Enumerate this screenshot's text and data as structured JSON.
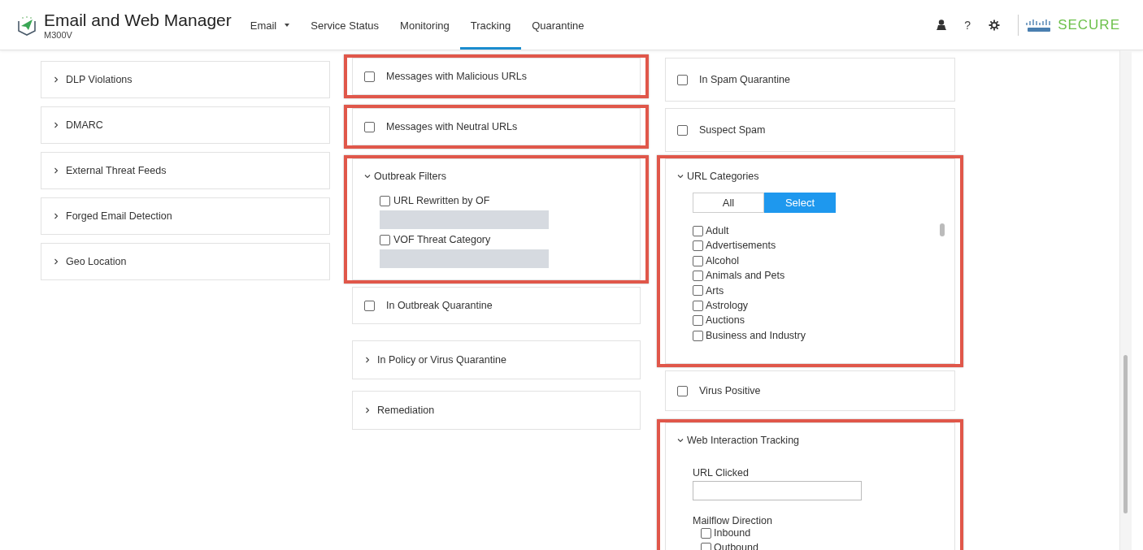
{
  "header": {
    "title": "Email and Web Manager",
    "model": "M300V",
    "nav": [
      {
        "label": "Email",
        "dropdown": true,
        "selected": false
      },
      {
        "label": "Service Status",
        "dropdown": false,
        "selected": false
      },
      {
        "label": "Monitoring",
        "dropdown": false,
        "selected": false
      },
      {
        "label": "Tracking",
        "dropdown": false,
        "selected": true
      },
      {
        "label": "Quarantine",
        "dropdown": false,
        "selected": false
      }
    ],
    "help": "?",
    "brand": "SECURE"
  },
  "columns": [
    {
      "cards": [
        {
          "kind": "collapsed",
          "label": "DLP Violations",
          "highlighted": false
        },
        {
          "kind": "collapsed",
          "label": "DMARC",
          "highlighted": false
        },
        {
          "kind": "collapsed",
          "label": "External Threat Feeds",
          "highlighted": false
        },
        {
          "kind": "collapsed",
          "label": "Forged Email Detection",
          "highlighted": false
        },
        {
          "kind": "collapsed",
          "label": "Geo Location",
          "highlighted": false
        }
      ]
    },
    {
      "cards": [
        {
          "kind": "checkbox",
          "label": "Messages with Malicious URLs",
          "checked": false,
          "highlighted": true
        },
        {
          "kind": "checkbox",
          "label": "Messages with Neutral URLs",
          "checked": false,
          "highlighted": true
        },
        {
          "kind": "expanded",
          "label": "Outbreak Filters",
          "highlighted": true,
          "content": [
            {
              "kind": "checkbox_bar",
              "label": "URL Rewritten by OF",
              "checked": false
            },
            {
              "kind": "checkbox_bar",
              "label": "VOF Threat Category",
              "checked": false
            }
          ]
        },
        {
          "kind": "checkbox",
          "label": "In Outbreak Quarantine",
          "checked": false,
          "highlighted": false
        },
        {
          "kind": "collapsed",
          "label": "In Policy or Virus Quarantine",
          "highlighted": false
        },
        {
          "kind": "collapsed",
          "label": "Remediation",
          "highlighted": false
        }
      ]
    },
    {
      "cards": [
        {
          "kind": "checkbox",
          "label": "In Spam Quarantine",
          "checked": false,
          "highlighted": false
        },
        {
          "kind": "checkbox",
          "label": "Suspect Spam",
          "checked": false,
          "highlighted": false
        },
        {
          "kind": "expanded",
          "label": "URL Categories",
          "highlighted": true,
          "content": [
            {
              "kind": "segmented",
              "options": [
                {
                  "label": "All",
                  "selected": false
                },
                {
                  "label": "Select",
                  "selected": true
                }
              ]
            },
            {
              "kind": "list",
              "items": [
                {
                  "label": "Adult",
                  "checked": false
                },
                {
                  "label": "Advertisements",
                  "checked": false
                },
                {
                  "label": "Alcohol",
                  "checked": false
                },
                {
                  "label": "Animals and Pets",
                  "checked": false
                },
                {
                  "label": "Arts",
                  "checked": false
                },
                {
                  "label": "Astrology",
                  "checked": false
                },
                {
                  "label": "Auctions",
                  "checked": false
                },
                {
                  "label": "Business and Industry",
                  "checked": false
                }
              ]
            }
          ]
        },
        {
          "kind": "checkbox",
          "label": "Virus Positive",
          "checked": false,
          "highlighted": false
        },
        {
          "kind": "expanded",
          "label": "Web Interaction Tracking",
          "highlighted": true,
          "content": [
            {
              "kind": "text_field",
              "label": "URL Clicked"
            },
            {
              "kind": "checkbox_group",
              "label": "Mailflow Direction",
              "items": [
                {
                  "label": "Inbound",
                  "checked": false
                },
                {
                  "label": "Outbound",
                  "checked": false
                }
              ]
            }
          ]
        }
      ]
    }
  ]
}
